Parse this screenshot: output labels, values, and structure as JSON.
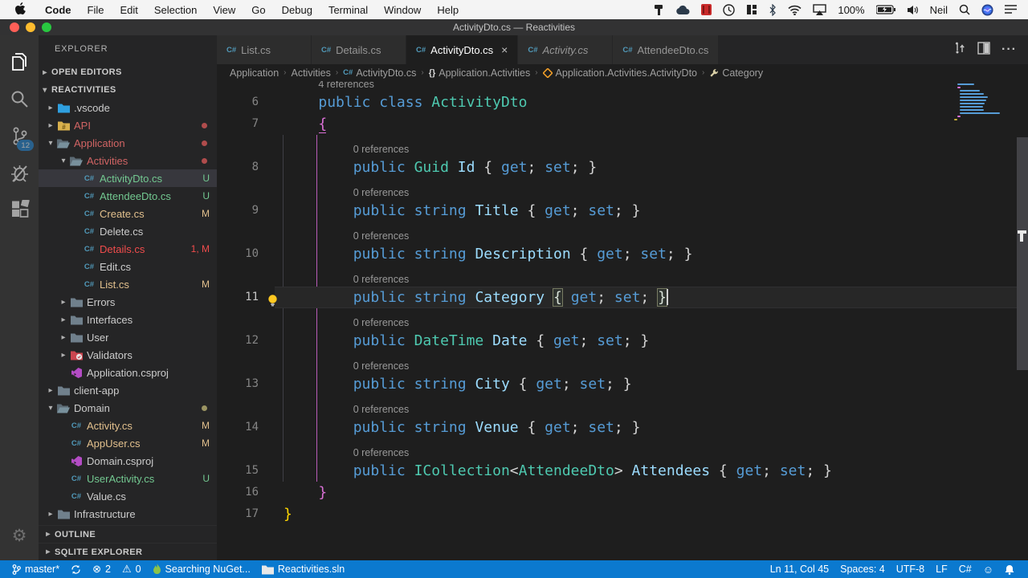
{
  "menu_bar": {
    "items": [
      "Code",
      "File",
      "Edit",
      "Selection",
      "View",
      "Go",
      "Debug",
      "Terminal",
      "Window",
      "Help"
    ],
    "battery": "100%",
    "user": "Neil",
    "status_icons": [
      "tool-icon",
      "cloud-icon",
      "video-icon",
      "history-icon",
      "layout-icon",
      "bluetooth-icon",
      "wifi-icon",
      "airplay-icon",
      "battery-icon",
      "volume-icon",
      "search-icon",
      "siri-icon",
      "list-icon"
    ]
  },
  "window": {
    "title": "ActivityDto.cs — Reactivities"
  },
  "tabs": [
    {
      "label": "List.cs",
      "active": false,
      "italic": false,
      "close": false
    },
    {
      "label": "Details.cs",
      "active": false,
      "italic": false,
      "close": false
    },
    {
      "label": "ActivityDto.cs",
      "active": true,
      "italic": false,
      "close": true
    },
    {
      "label": "Activity.cs",
      "active": false,
      "italic": true,
      "close": false
    },
    {
      "label": "AttendeeDto.cs",
      "active": false,
      "italic": false,
      "close": false
    }
  ],
  "breadcrumbs": [
    {
      "label": "Application",
      "icon": null
    },
    {
      "label": "Activities",
      "icon": null
    },
    {
      "label": "ActivityDto.cs",
      "icon": "csharp-icon"
    },
    {
      "label": "Application.Activities",
      "icon": "namespace-icon"
    },
    {
      "label": "Application.Activities.ActivityDto",
      "icon": "class-icon"
    },
    {
      "label": "Category",
      "icon": "wrench-icon"
    }
  ],
  "activity_bar": {
    "badge": "12"
  },
  "explorer": {
    "title": "EXPLORER",
    "sections": {
      "open_editors": "OPEN EDITORS",
      "root": "REACTIVITIES",
      "outline": "OUTLINE",
      "sqlite": "SQLITE EXPLORER"
    },
    "items": [
      {
        "label": ".vscode",
        "indent": 1,
        "icon": "folder-vscode",
        "arrow": "right"
      },
      {
        "label": "API",
        "indent": 1,
        "icon": "folder-api",
        "arrow": "right",
        "color": "#d16464",
        "dot": "#b04c4c"
      },
      {
        "label": "Application",
        "indent": 1,
        "icon": "folder-open",
        "arrow": "down",
        "color": "#d16464",
        "dot": "#b04c4c"
      },
      {
        "label": "Activities",
        "indent": 2,
        "icon": "folder-open",
        "arrow": "down",
        "color": "#d16464",
        "dot": "#b04c4c"
      },
      {
        "label": "ActivityDto.cs",
        "indent": 3,
        "icon": "csharp",
        "color": "#73c991",
        "badge": "U",
        "selected": true
      },
      {
        "label": "AttendeeDto.cs",
        "indent": 3,
        "icon": "csharp",
        "color": "#73c991",
        "badge": "U"
      },
      {
        "label": "Create.cs",
        "indent": 3,
        "icon": "csharp",
        "color": "#e2c08d",
        "badge": "M"
      },
      {
        "label": "Delete.cs",
        "indent": 3,
        "icon": "csharp",
        "color": "#cccccc"
      },
      {
        "label": "Details.cs",
        "indent": 3,
        "icon": "csharp",
        "color": "#f14c4c",
        "badge": "1, M"
      },
      {
        "label": "Edit.cs",
        "indent": 3,
        "icon": "csharp",
        "color": "#cccccc"
      },
      {
        "label": "List.cs",
        "indent": 3,
        "icon": "csharp",
        "color": "#e2c08d",
        "badge": "M"
      },
      {
        "label": "Errors",
        "indent": 2,
        "icon": "folder",
        "arrow": "right"
      },
      {
        "label": "Interfaces",
        "indent": 2,
        "icon": "folder",
        "arrow": "right"
      },
      {
        "label": "User",
        "indent": 2,
        "icon": "folder",
        "arrow": "right"
      },
      {
        "label": "Validators",
        "indent": 2,
        "icon": "folder-validators",
        "arrow": "right"
      },
      {
        "label": "Application.csproj",
        "indent": 2,
        "icon": "csproj",
        "color": "#cccccc"
      },
      {
        "label": "client-app",
        "indent": 1,
        "icon": "folder",
        "arrow": "right"
      },
      {
        "label": "Domain",
        "indent": 1,
        "icon": "folder-open",
        "arrow": "down",
        "dot": "#9b9462"
      },
      {
        "label": "Activity.cs",
        "indent": 2,
        "icon": "csharp",
        "color": "#e2c08d",
        "badge": "M"
      },
      {
        "label": "AppUser.cs",
        "indent": 2,
        "icon": "csharp",
        "color": "#e2c08d",
        "badge": "M"
      },
      {
        "label": "Domain.csproj",
        "indent": 2,
        "icon": "csproj",
        "color": "#cccccc"
      },
      {
        "label": "UserActivity.cs",
        "indent": 2,
        "icon": "csharp",
        "color": "#73c991",
        "badge": "U"
      },
      {
        "label": "Value.cs",
        "indent": 2,
        "icon": "csharp",
        "color": "#cccccc"
      },
      {
        "label": "Infrastructure",
        "indent": 1,
        "icon": "folder",
        "arrow": "right"
      }
    ]
  },
  "code": {
    "language": "csharp",
    "rows": [
      {
        "lens": "4 references",
        "ind": 4
      },
      {
        "n": "6",
        "segs": [
          [
            "    ",
            "d"
          ],
          [
            "public",
            "k"
          ],
          [
            " ",
            "d"
          ],
          [
            "class",
            "k"
          ],
          [
            " ",
            "d"
          ],
          [
            "ActivityDto",
            "t"
          ]
        ]
      },
      {
        "n": "7",
        "segs": [
          [
            "    ",
            "d"
          ],
          [
            "{",
            "ou"
          ]
        ]
      },
      {
        "lens": "0 references",
        "ind": 8
      },
      {
        "n": "8",
        "segs": [
          [
            "        ",
            "d"
          ],
          [
            "public",
            "k"
          ],
          [
            " ",
            "d"
          ],
          [
            "Guid",
            "t"
          ],
          [
            " ",
            "d"
          ],
          [
            "Id",
            "p"
          ],
          [
            " { ",
            "d"
          ],
          [
            "get",
            "k"
          ],
          [
            "; ",
            "d"
          ],
          [
            "set",
            "k"
          ],
          [
            "; ",
            "d"
          ],
          [
            "}",
            "d"
          ]
        ]
      },
      {
        "lens": "0 references",
        "ind": 8
      },
      {
        "n": "9",
        "segs": [
          [
            "        ",
            "d"
          ],
          [
            "public",
            "k"
          ],
          [
            " ",
            "d"
          ],
          [
            "string",
            "k"
          ],
          [
            " ",
            "d"
          ],
          [
            "Title",
            "p"
          ],
          [
            " { ",
            "d"
          ],
          [
            "get",
            "k"
          ],
          [
            "; ",
            "d"
          ],
          [
            "set",
            "k"
          ],
          [
            "; ",
            "d"
          ],
          [
            "}",
            "d"
          ]
        ]
      },
      {
        "lens": "0 references",
        "ind": 8
      },
      {
        "n": "10",
        "segs": [
          [
            "        ",
            "d"
          ],
          [
            "public",
            "k"
          ],
          [
            " ",
            "d"
          ],
          [
            "string",
            "k"
          ],
          [
            " ",
            "d"
          ],
          [
            "Description",
            "p"
          ],
          [
            " { ",
            "d"
          ],
          [
            "get",
            "k"
          ],
          [
            "; ",
            "d"
          ],
          [
            "set",
            "k"
          ],
          [
            "; ",
            "d"
          ],
          [
            "}",
            "d"
          ]
        ]
      },
      {
        "lens": "0 references",
        "ind": 8
      },
      {
        "n": "11",
        "current": true,
        "segs": [
          [
            "        ",
            "d"
          ],
          [
            "public",
            "k"
          ],
          [
            " ",
            "d"
          ],
          [
            "string",
            "k"
          ],
          [
            " ",
            "d"
          ],
          [
            "Category",
            "p"
          ],
          [
            " ",
            "d"
          ],
          [
            "{",
            "m"
          ],
          [
            " ",
            "d"
          ],
          [
            "get",
            "k"
          ],
          [
            "; ",
            "d"
          ],
          [
            "set",
            "k"
          ],
          [
            "; ",
            "d"
          ],
          [
            "}",
            "m"
          ]
        ]
      },
      {
        "lens": "0 references",
        "ind": 8
      },
      {
        "n": "12",
        "segs": [
          [
            "        ",
            "d"
          ],
          [
            "public",
            "k"
          ],
          [
            " ",
            "d"
          ],
          [
            "DateTime",
            "t"
          ],
          [
            " ",
            "d"
          ],
          [
            "Date",
            "p"
          ],
          [
            " { ",
            "d"
          ],
          [
            "get",
            "k"
          ],
          [
            "; ",
            "d"
          ],
          [
            "set",
            "k"
          ],
          [
            "; ",
            "d"
          ],
          [
            "}",
            "d"
          ]
        ]
      },
      {
        "lens": "0 references",
        "ind": 8
      },
      {
        "n": "13",
        "segs": [
          [
            "        ",
            "d"
          ],
          [
            "public",
            "k"
          ],
          [
            " ",
            "d"
          ],
          [
            "string",
            "k"
          ],
          [
            " ",
            "d"
          ],
          [
            "City",
            "p"
          ],
          [
            " { ",
            "d"
          ],
          [
            "get",
            "k"
          ],
          [
            "; ",
            "d"
          ],
          [
            "set",
            "k"
          ],
          [
            "; ",
            "d"
          ],
          [
            "}",
            "d"
          ]
        ]
      },
      {
        "lens": "0 references",
        "ind": 8
      },
      {
        "n": "14",
        "segs": [
          [
            "        ",
            "d"
          ],
          [
            "public",
            "k"
          ],
          [
            " ",
            "d"
          ],
          [
            "string",
            "k"
          ],
          [
            " ",
            "d"
          ],
          [
            "Venue",
            "p"
          ],
          [
            " { ",
            "d"
          ],
          [
            "get",
            "k"
          ],
          [
            "; ",
            "d"
          ],
          [
            "set",
            "k"
          ],
          [
            "; ",
            "d"
          ],
          [
            "}",
            "d"
          ]
        ]
      },
      {
        "lens": "0 references",
        "ind": 8
      },
      {
        "n": "15",
        "segs": [
          [
            "        ",
            "d"
          ],
          [
            "public",
            "k"
          ],
          [
            " ",
            "d"
          ],
          [
            "ICollection",
            "t"
          ],
          [
            "<",
            "d"
          ],
          [
            "AttendeeDto",
            "t"
          ],
          [
            ">",
            "d"
          ],
          [
            " ",
            "d"
          ],
          [
            "Attendees",
            "p"
          ],
          [
            " { ",
            "d"
          ],
          [
            "get",
            "k"
          ],
          [
            "; ",
            "d"
          ],
          [
            "set",
            "k"
          ],
          [
            "; ",
            "d"
          ],
          [
            "}",
            "d"
          ]
        ]
      },
      {
        "n": "16",
        "segs": [
          [
            "    ",
            "d"
          ],
          [
            "}",
            "o"
          ]
        ]
      },
      {
        "n": "17",
        "segs": [
          [
            "}",
            "g"
          ]
        ]
      }
    ]
  },
  "status_bar": {
    "left": [
      {
        "icon": "branch-icon",
        "label": "master*"
      },
      {
        "icon": "sync-icon",
        "label": ""
      },
      {
        "icon": "error-icon",
        "label": "2"
      },
      {
        "icon": "warning-icon",
        "label": "0"
      },
      {
        "icon": "flame-icon",
        "label": "Searching NuGet..."
      },
      {
        "icon": "folder-icon",
        "label": "Reactivities.sln"
      }
    ],
    "right": [
      {
        "icon": null,
        "label": "Ln 11, Col 45"
      },
      {
        "icon": null,
        "label": "Spaces: 4"
      },
      {
        "icon": null,
        "label": "UTF-8"
      },
      {
        "icon": null,
        "label": "LF"
      },
      {
        "icon": null,
        "label": "C#"
      },
      {
        "icon": "smiley-icon",
        "label": ""
      },
      {
        "icon": "bell-icon",
        "label": ""
      }
    ]
  }
}
